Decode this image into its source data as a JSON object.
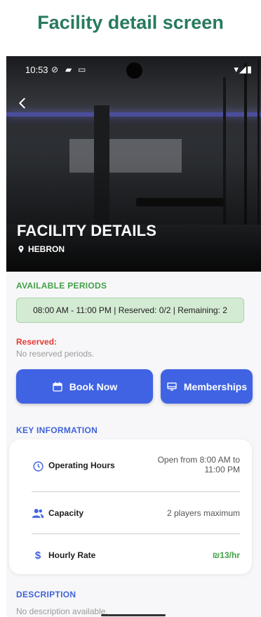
{
  "caption": "Facility detail screen",
  "status_bar": {
    "time": "10:53"
  },
  "hero": {
    "title": "FACILITY DETAILS",
    "location": "HEBRON"
  },
  "available_periods": {
    "heading": "AVAILABLE PERIODS",
    "period_text": "08:00 AM - 11:00 PM  | Reserved: 0/2 | Remaining: 2"
  },
  "reserved": {
    "label": "Reserved:",
    "empty_text": "No reserved periods."
  },
  "actions": {
    "book_label": "Book Now",
    "memberships_label": "Memberships"
  },
  "key_info": {
    "heading": "KEY INFORMATION",
    "rows": [
      {
        "label": "Operating Hours",
        "value_line1": "Open from 8:00 AM to",
        "value_line2": "11:00 PM",
        "icon": "clock-icon"
      },
      {
        "label": "Capacity",
        "value": "2 players maximum",
        "icon": "people-icon"
      },
      {
        "label": "Hourly Rate",
        "value": "₪13/hr",
        "icon": "dollar-icon"
      }
    ]
  },
  "description": {
    "heading": "DESCRIPTION",
    "text": "No description available."
  },
  "colors": {
    "accent": "#3f63e3",
    "success": "#43a047",
    "danger": "#e53935",
    "caption": "#287a5e",
    "rate": "#43a047"
  }
}
